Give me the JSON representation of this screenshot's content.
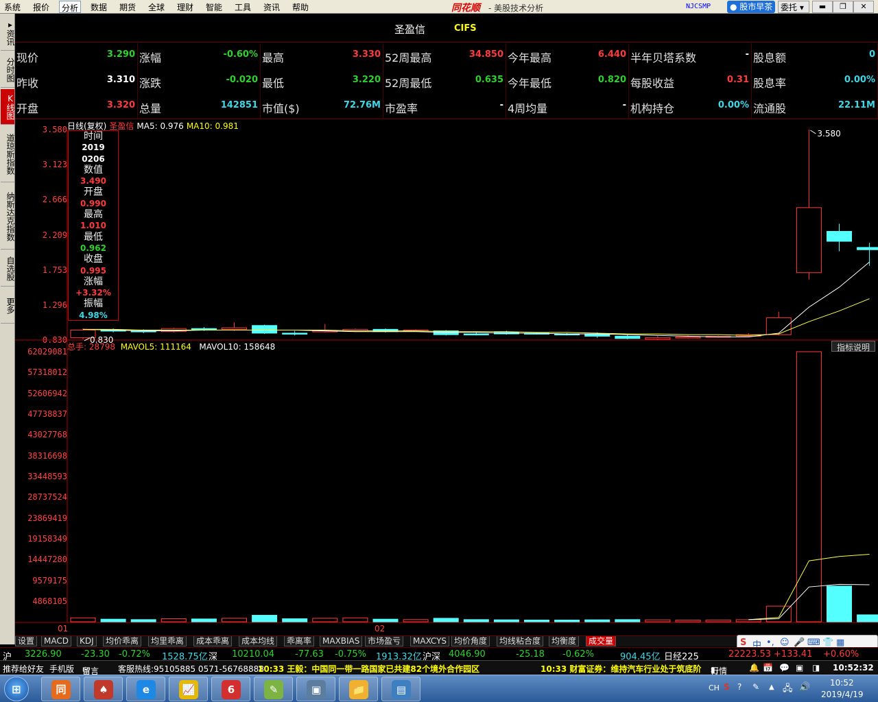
{
  "menu": {
    "items": [
      "系统",
      "报价",
      "分析",
      "数据",
      "期货",
      "全球",
      "理财",
      "智能",
      "工具",
      "资讯",
      "帮助"
    ],
    "active_index": 2,
    "brand": "同花顺",
    "title": "- 美股技术分析",
    "ticker": "NJCSMP",
    "early_btn": "股市早茶",
    "commission_btn": "委托",
    "win_min": "▬",
    "win_restore": "❐",
    "win_close": "✕"
  },
  "left_tabs": [
    {
      "label": "资讯",
      "active": false
    },
    {
      "label": "分时图",
      "active": false
    },
    {
      "label": "K线图",
      "active": true
    },
    {
      "label": "道琼斯指数",
      "active": false
    },
    {
      "label": "纳斯达克指数",
      "active": false
    },
    {
      "label": "自选股",
      "active": false
    },
    {
      "label": "更多",
      "active": false
    }
  ],
  "stock": {
    "name": "圣盈信",
    "code": "CIFS"
  },
  "quotes": [
    [
      {
        "label": "现价",
        "value": "3.290",
        "color": "green"
      },
      {
        "label": "涨幅",
        "value": "-0.60%",
        "color": "green"
      },
      {
        "label": "最高",
        "value": "3.330",
        "color": "red"
      },
      {
        "label": "52周最高",
        "value": "34.850",
        "color": "red"
      },
      {
        "label": "今年最高",
        "value": "6.440",
        "color": "red"
      },
      {
        "label": "半年贝塔系数",
        "value": "-",
        "color": "white"
      },
      {
        "label": "股息额",
        "value": "0",
        "color": "cyan"
      }
    ],
    [
      {
        "label": "昨收",
        "value": "3.310",
        "color": "white"
      },
      {
        "label": "涨跌",
        "value": "-0.020",
        "color": "green"
      },
      {
        "label": "最低",
        "value": "3.220",
        "color": "green"
      },
      {
        "label": "52周最低",
        "value": "0.635",
        "color": "green"
      },
      {
        "label": "今年最低",
        "value": "0.820",
        "color": "green"
      },
      {
        "label": "每股收益",
        "value": "0.31",
        "color": "red"
      },
      {
        "label": "股息率",
        "value": "0.00%",
        "color": "cyan"
      }
    ],
    [
      {
        "label": "开盘",
        "value": "3.320",
        "color": "red"
      },
      {
        "label": "总量",
        "value": "142851",
        "color": "cyan"
      },
      {
        "label": "市值($)",
        "value": "72.76M",
        "color": "cyan"
      },
      {
        "label": "市盈率",
        "value": "-",
        "color": "white"
      },
      {
        "label": "4周均量",
        "value": "-",
        "color": "white"
      },
      {
        "label": "机构持仓",
        "value": "0.00%",
        "color": "cyan"
      },
      {
        "label": "流通股",
        "value": "22.11M",
        "color": "cyan"
      }
    ]
  ],
  "kline_header": {
    "title": "日线(复权)",
    "stock": "圣盈信",
    "ma5": "MA5: 0.976",
    "ma10": "MA10: 0.981"
  },
  "kline_yaxis": [
    "3.580",
    "3.123",
    "2.666",
    "2.209",
    "1.753",
    "1.296",
    "0.830"
  ],
  "kline_high_label": "3.580",
  "kline_low_label": "0.830",
  "tooltip": [
    {
      "label": "时间",
      "value": "2019",
      "value2": "0206",
      "color": "white"
    },
    {
      "label": "数值",
      "value": "3.490",
      "color": "red"
    },
    {
      "label": "开盘",
      "value": "0.990",
      "color": "red"
    },
    {
      "label": "最高",
      "value": "1.010",
      "color": "red"
    },
    {
      "label": "最低",
      "value": "0.962",
      "color": "green"
    },
    {
      "label": "收盘",
      "value": "0.995",
      "color": "red"
    },
    {
      "label": "涨幅",
      "value": "+3.32%",
      "color": "red"
    },
    {
      "label": "振幅",
      "value": "4.98%",
      "color": "cyan"
    }
  ],
  "volume_header": {
    "total": "总手: 28798",
    "mavol5": "MAVOL5: 111164",
    "mavol10": "MAVOL10: 158648",
    "indicator_btn": "指标说明"
  },
  "volume_yaxis": [
    "62029081",
    "57318012",
    "52606942",
    "47738837",
    "43027768",
    "38316698",
    "33448593",
    "28737524",
    "23869419",
    "19158349",
    "14447280",
    "9579175",
    "4868105",
    "01"
  ],
  "x_labels": [
    "02"
  ],
  "chart_data": {
    "type": "candlestick",
    "ylim": [
      0.83,
      3.58
    ],
    "volume_ylim": [
      0,
      62029081
    ],
    "candles": [
      {
        "o": 0.86,
        "c": 0.96,
        "h": 0.98,
        "l": 0.84,
        "v": 900000
      },
      {
        "o": 0.96,
        "c": 0.95,
        "h": 0.98,
        "l": 0.93,
        "v": 600000
      },
      {
        "o": 0.95,
        "c": 0.94,
        "h": 0.97,
        "l": 0.92,
        "v": 500000
      },
      {
        "o": 0.94,
        "c": 0.98,
        "h": 0.99,
        "l": 0.93,
        "v": 700000
      },
      {
        "o": 0.98,
        "c": 0.97,
        "h": 1.0,
        "l": 0.95,
        "v": 650000
      },
      {
        "o": 0.97,
        "c": 0.99,
        "h": 1.06,
        "l": 0.95,
        "v": 800000
      },
      {
        "o": 1.02,
        "c": 0.92,
        "h": 1.03,
        "l": 0.91,
        "v": 1500000
      },
      {
        "o": 0.92,
        "c": 0.91,
        "h": 0.95,
        "l": 0.89,
        "v": 700000
      },
      {
        "o": 0.94,
        "c": 0.95,
        "h": 1.04,
        "l": 0.93,
        "v": 800000
      },
      {
        "o": 0.95,
        "c": 0.97,
        "h": 0.98,
        "l": 0.94,
        "v": 900000
      },
      {
        "o": 0.97,
        "c": 0.94,
        "h": 0.98,
        "l": 0.93,
        "v": 600000
      },
      {
        "o": 0.95,
        "c": 0.96,
        "h": 0.97,
        "l": 0.94,
        "v": 500000
      },
      {
        "o": 0.95,
        "c": 0.9,
        "h": 0.96,
        "l": 0.89,
        "v": 800000
      },
      {
        "o": 0.91,
        "c": 0.9,
        "h": 0.93,
        "l": 0.89,
        "v": 500000
      },
      {
        "o": 0.93,
        "c": 0.91,
        "h": 0.95,
        "l": 0.9,
        "v": 450000
      },
      {
        "o": 0.92,
        "c": 0.91,
        "h": 0.93,
        "l": 0.9,
        "v": 400000
      },
      {
        "o": 0.91,
        "c": 0.9,
        "h": 0.92,
        "l": 0.89,
        "v": 400000
      },
      {
        "o": 0.91,
        "c": 0.88,
        "h": 0.93,
        "l": 0.86,
        "v": 450000
      },
      {
        "o": 0.88,
        "c": 0.85,
        "h": 0.9,
        "l": 0.84,
        "v": 500000
      },
      {
        "o": 0.84,
        "c": 0.86,
        "h": 0.88,
        "l": 0.83,
        "v": 450000
      },
      {
        "o": 0.86,
        "c": 0.87,
        "h": 0.89,
        "l": 0.85,
        "v": 400000
      },
      {
        "o": 0.87,
        "c": 0.88,
        "h": 0.89,
        "l": 0.86,
        "v": 420000
      },
      {
        "o": 0.88,
        "c": 0.9,
        "h": 0.92,
        "l": 0.87,
        "v": 480000
      },
      {
        "o": 0.9,
        "c": 1.12,
        "h": 1.2,
        "l": 0.89,
        "v": 3600000
      },
      {
        "o": 1.71,
        "c": 2.56,
        "h": 3.58,
        "l": 1.62,
        "v": 62029081
      },
      {
        "o": 2.25,
        "c": 2.12,
        "h": 2.35,
        "l": 1.99,
        "v": 8200000
      },
      {
        "o": 2.04,
        "c": 2.01,
        "h": 2.1,
        "l": 1.8,
        "v": 1600000
      }
    ],
    "ma5": [
      0.97,
      0.96,
      0.95,
      0.95,
      0.96,
      0.96,
      0.96,
      0.96,
      0.95,
      0.94,
      0.94,
      0.94,
      0.93,
      0.93,
      0.92,
      0.92,
      0.91,
      0.91,
      0.9,
      0.89,
      0.88,
      0.87,
      0.87,
      0.92,
      1.26,
      1.52,
      1.85
    ],
    "ma10": [
      0.97,
      0.97,
      0.96,
      0.96,
      0.96,
      0.96,
      0.96,
      0.96,
      0.96,
      0.95,
      0.95,
      0.95,
      0.94,
      0.94,
      0.94,
      0.93,
      0.93,
      0.92,
      0.91,
      0.91,
      0.9,
      0.9,
      0.89,
      0.91,
      1.07,
      1.21,
      1.37
    ],
    "mavol5": [
      0,
      0,
      0,
      0,
      0,
      0,
      0,
      0,
      0,
      0,
      0,
      0,
      0,
      0,
      0,
      0,
      0,
      0,
      0,
      0,
      0,
      0,
      500000,
      1000000,
      14000000,
      15000000,
      15500000
    ],
    "mavol10": [
      0,
      0,
      0,
      0,
      0,
      0,
      0,
      0,
      0,
      0,
      0,
      0,
      0,
      0,
      0,
      0,
      0,
      0,
      0,
      0,
      0,
      0,
      500000,
      700000,
      8000000,
      8600000,
      8500000
    ]
  },
  "indicator_tabs": [
    "设置",
    "MACD",
    "KDJ",
    "均价乖离",
    "均里乖离",
    "成本乖离",
    "成本均线",
    "乖离率",
    "MAXBIAS",
    "市场盈亏",
    "MAXCYS",
    "均价角度",
    "均线粘合度",
    "均衡度",
    "成交量"
  ],
  "indicator_active": 14,
  "index_bar": [
    {
      "text": "沪",
      "color": "white"
    },
    {
      "text": "3226.90",
      "color": "green"
    },
    {
      "text": "-23.30",
      "color": "green"
    },
    {
      "text": "-0.72%",
      "color": "green"
    },
    {
      "text": "1528.75亿",
      "color": "cyan"
    },
    {
      "text": "深",
      "color": "white"
    },
    {
      "text": "10210.04",
      "color": "green"
    },
    {
      "text": "-77.63",
      "color": "green"
    },
    {
      "text": "-0.75%",
      "color": "green"
    },
    {
      "text": "1913.32亿",
      "color": "cyan"
    },
    {
      "text": "沪深",
      "color": "white"
    },
    {
      "text": "4046.90",
      "color": "green"
    },
    {
      "text": "-25.18",
      "color": "green"
    },
    {
      "text": "-0.62%",
      "color": "green"
    },
    {
      "text": "904.45亿",
      "color": "cyan"
    },
    {
      "text": "日经225",
      "color": "white"
    },
    {
      "text": "22223.53",
      "color": "red"
    },
    {
      "text": "+133.41",
      "color": "red"
    },
    {
      "text": "+0.60%",
      "color": "red"
    }
  ],
  "news_bar": {
    "recommend": "推荐给好友",
    "mobile": "手机版",
    "message": "留言",
    "hotline": "客服热线:95105885 0571-56768888",
    "news1": "10:33 王毅：中国同一带一路国家已共建82个境外合作园区",
    "news2": "10:33 财富证券：维持汽车行业处于筑底阶",
    "quote_btn": "行情",
    "time": "10:52:32"
  },
  "ime": {
    "lang": "中",
    "label": "CH"
  },
  "taskbar": {
    "start": "⊞",
    "items": [
      "同",
      "♠",
      "e",
      "📈",
      "6",
      "✎",
      "▣",
      "📁",
      "▤"
    ],
    "clock_time": "10:52",
    "clock_date": "2019/4/19"
  }
}
